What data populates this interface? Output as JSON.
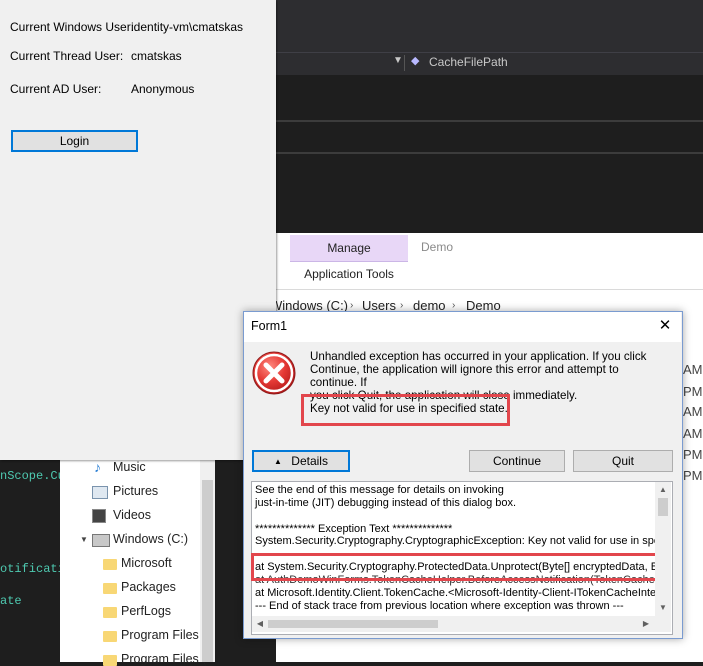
{
  "form": {
    "windows_user_label": "Current Windows User:",
    "windows_user_value": "identity-vm\\cmatskas",
    "thread_user_label": "Current Thread User:",
    "thread_user_value": "cmatskas",
    "ad_user_label": "Current AD User:",
    "ad_user_value": "Anonymous",
    "login_label": "Login"
  },
  "vs": {
    "member_dropdown": "CacheFilePath",
    "code_fragments": [
      "nScope.Cu",
      "otificati",
      "ate"
    ]
  },
  "explorer": {
    "ribbon": {
      "manage": "Manage",
      "app_tools": "Application Tools",
      "tab_demo": "Demo"
    },
    "breadcrumb": [
      "Windows (C:)",
      "Users",
      "demo",
      "Demo"
    ],
    "time_fragments": [
      "AM",
      "PM",
      "AM",
      "AM",
      "PM",
      "PM"
    ],
    "nav_items": [
      "Music",
      "Pictures",
      "Videos",
      "Windows (C:)",
      "Microsoft",
      "Packages",
      "PerfLogs",
      "Program Files",
      "Program Files ("
    ]
  },
  "dialog": {
    "title": "Form1",
    "message_line1": "Unhandled exception has occurred in your application. If you click",
    "message_line2": "Continue, the application will ignore this error and attempt to continue. If",
    "message_line3": "you click Quit, the application will close immediately.",
    "error_message": "Key not valid for use in specified state.",
    "details_label": "Details",
    "continue_label": "Continue",
    "quit_label": "Quit",
    "details_lines": [
      "See the end of this message for details on invoking",
      "just-in-time (JIT) debugging instead of this dialog box.",
      "",
      "************** Exception Text **************",
      "System.Security.Cryptography.CryptographicException: Key not valid for use in specif",
      "   at System.Security.Cryptography.ProtectedData.Unprotect(Byte[] encryptedData, B",
      "   at AuthDemoWinForms.TokenCacheHelper.BeforeAccessNotification(TokenCache",
      "   at Microsoft.Identity.Client.TokenCache.<Microsoft-Identity-Client-ITokenCacheInte",
      "--- End of stack trace from previous location where exception was thrown ---"
    ]
  },
  "colors": {
    "highlight": "#e2464c",
    "accent": "#0078d7",
    "manage_tab": "#e8d7f7"
  }
}
